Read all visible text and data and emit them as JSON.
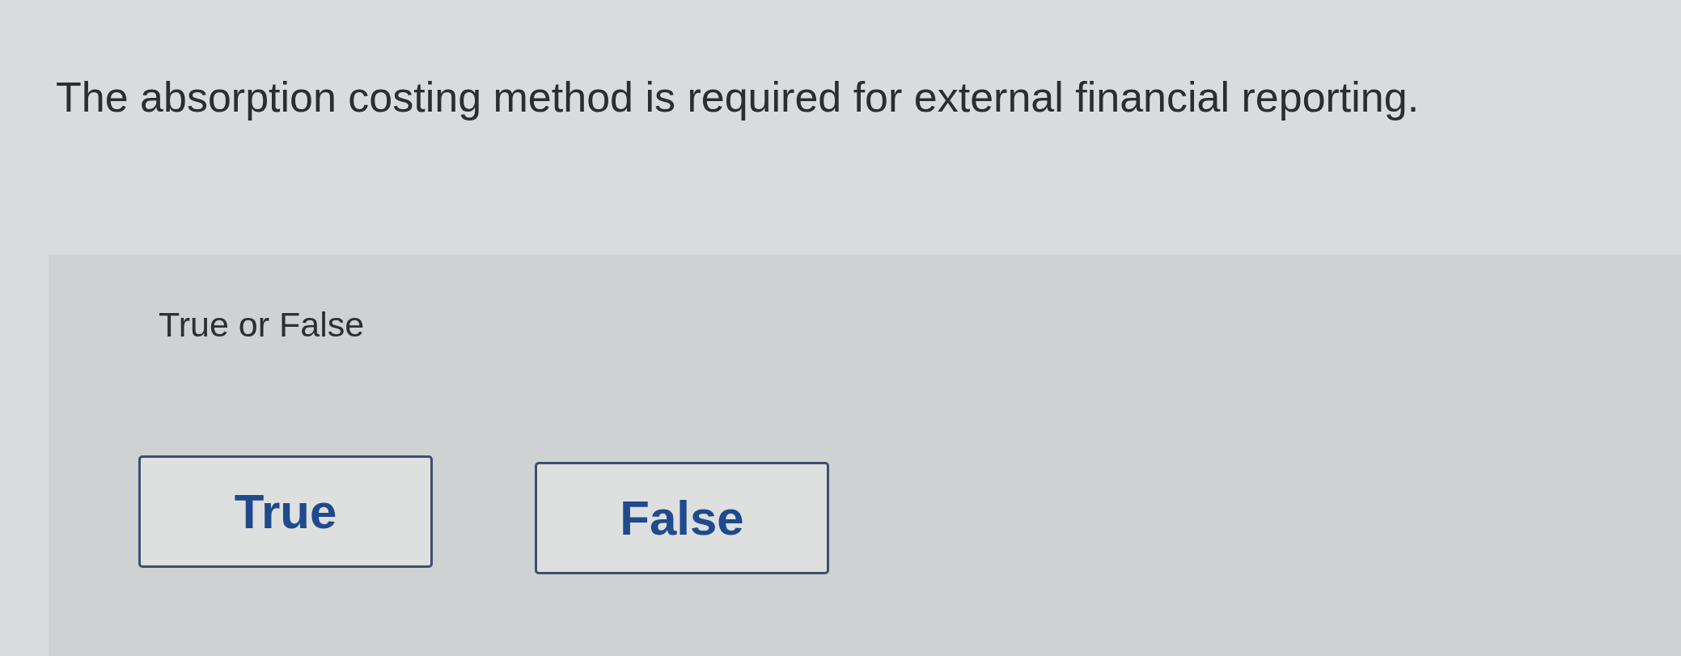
{
  "question": {
    "text": "The absorption costing method is required for external financial reporting."
  },
  "answer_panel": {
    "prompt": "True or False",
    "choices": [
      {
        "label": "True",
        "selected": false
      },
      {
        "label": "False",
        "selected": false
      }
    ]
  }
}
